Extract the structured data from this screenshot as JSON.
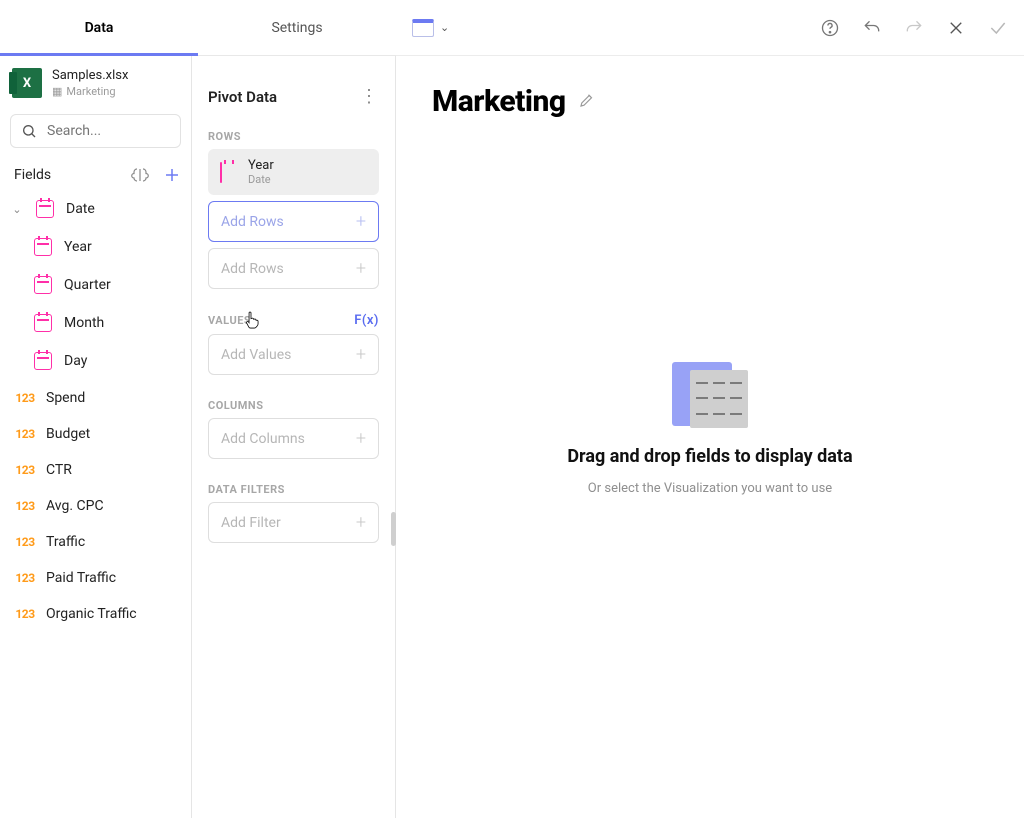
{
  "tabs": {
    "data": "Data",
    "settings": "Settings"
  },
  "file": {
    "name": "Samples.xlsx",
    "sheet": "Marketing"
  },
  "search": {
    "placeholder": "Search..."
  },
  "fields": {
    "label": "Fields",
    "items": [
      {
        "kind": "date-group",
        "label": "Date"
      },
      {
        "kind": "date",
        "label": "Year"
      },
      {
        "kind": "date",
        "label": "Quarter"
      },
      {
        "kind": "date",
        "label": "Month"
      },
      {
        "kind": "date",
        "label": "Day"
      },
      {
        "kind": "num",
        "label": "Spend"
      },
      {
        "kind": "num",
        "label": "Budget"
      },
      {
        "kind": "num",
        "label": "CTR"
      },
      {
        "kind": "num",
        "label": "Avg. CPC"
      },
      {
        "kind": "num",
        "label": "Traffic"
      },
      {
        "kind": "num",
        "label": "Paid Traffic"
      },
      {
        "kind": "num",
        "label": "Organic Traffic"
      }
    ]
  },
  "pivot": {
    "title": "Pivot Data",
    "rows_label": "ROWS",
    "row_chip": {
      "name": "Year",
      "sub": "Date"
    },
    "add_rows": "Add Rows",
    "values_label": "VALUES",
    "fx": "F(x)",
    "add_values": "Add Values",
    "columns_label": "COLUMNS",
    "add_columns": "Add Columns",
    "filters_label": "DATA FILTERS",
    "add_filter": "Add Filter"
  },
  "main": {
    "title": "Marketing",
    "placeholder_title": "Drag and drop fields to display data",
    "placeholder_sub": "Or select the Visualization you want to use"
  },
  "num_glyph": "123"
}
